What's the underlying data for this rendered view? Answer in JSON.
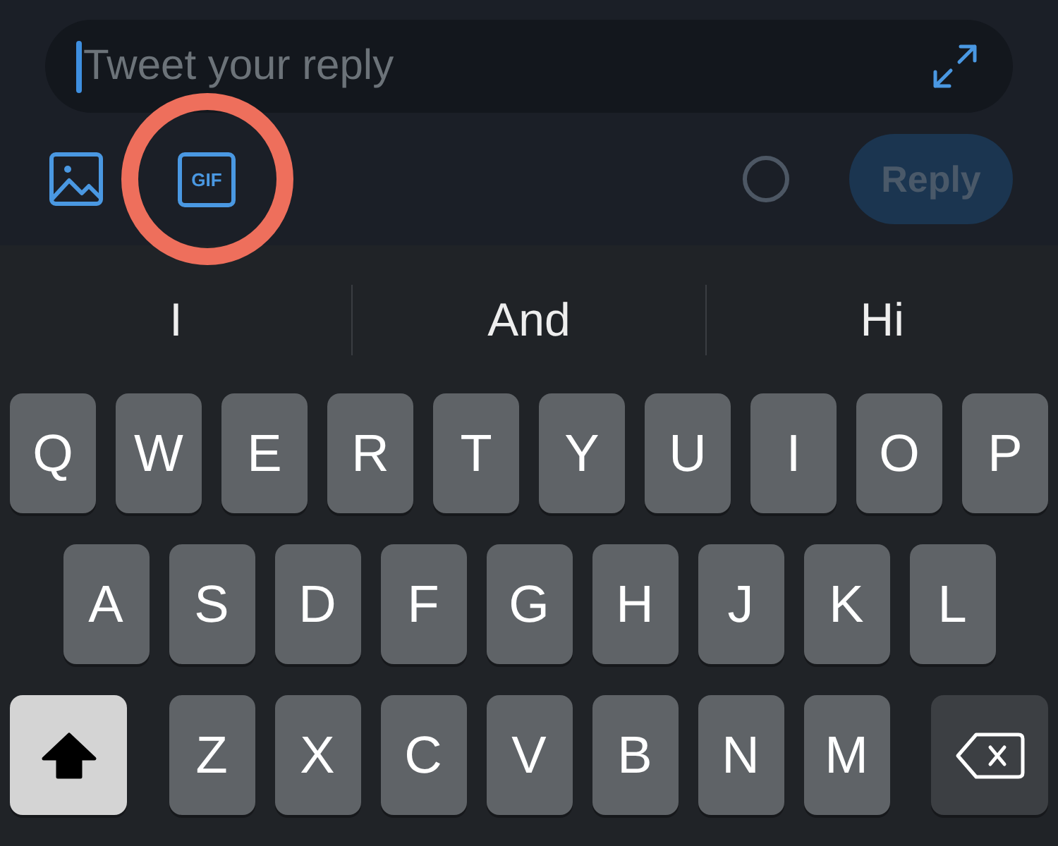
{
  "compose": {
    "field": {
      "placeholder": "Tweet your reply",
      "focused": true
    }
  },
  "toolbar": {
    "buttons": [
      {
        "kind": "image",
        "highlighted": false
      },
      {
        "kind": "gif",
        "label": "GIF",
        "highlighted": true
      }
    ],
    "reply": {
      "label": "Reply",
      "disabled": true
    }
  },
  "keyboard": {
    "suggestions": [
      "I",
      "And",
      "Hi"
    ],
    "rows": [
      {
        "keys": [
          {
            "kind": "letter",
            "label": "Q"
          },
          {
            "kind": "letter",
            "label": "W"
          },
          {
            "kind": "letter",
            "label": "E"
          },
          {
            "kind": "letter",
            "label": "R"
          },
          {
            "kind": "letter",
            "label": "T"
          },
          {
            "kind": "letter",
            "label": "Y"
          },
          {
            "kind": "letter",
            "label": "U"
          },
          {
            "kind": "letter",
            "label": "I"
          },
          {
            "kind": "letter",
            "label": "O"
          },
          {
            "kind": "letter",
            "label": "P"
          }
        ]
      },
      {
        "keys": [
          {
            "kind": "letter",
            "label": "A"
          },
          {
            "kind": "letter",
            "label": "S"
          },
          {
            "kind": "letter",
            "label": "D"
          },
          {
            "kind": "letter",
            "label": "F"
          },
          {
            "kind": "letter",
            "label": "G"
          },
          {
            "kind": "letter",
            "label": "H"
          },
          {
            "kind": "letter",
            "label": "J"
          },
          {
            "kind": "letter",
            "label": "K"
          },
          {
            "kind": "letter",
            "label": "L"
          }
        ]
      },
      {
        "keys": [
          {
            "kind": "shift",
            "on": true
          },
          {
            "kind": "letter",
            "label": "Z"
          },
          {
            "kind": "letter",
            "label": "X"
          },
          {
            "kind": "letter",
            "label": "C"
          },
          {
            "kind": "letter",
            "label": "V"
          },
          {
            "kind": "letter",
            "label": "B"
          },
          {
            "kind": "letter",
            "label": "N"
          },
          {
            "kind": "letter",
            "label": "M"
          },
          {
            "kind": "delete"
          }
        ]
      }
    ]
  }
}
